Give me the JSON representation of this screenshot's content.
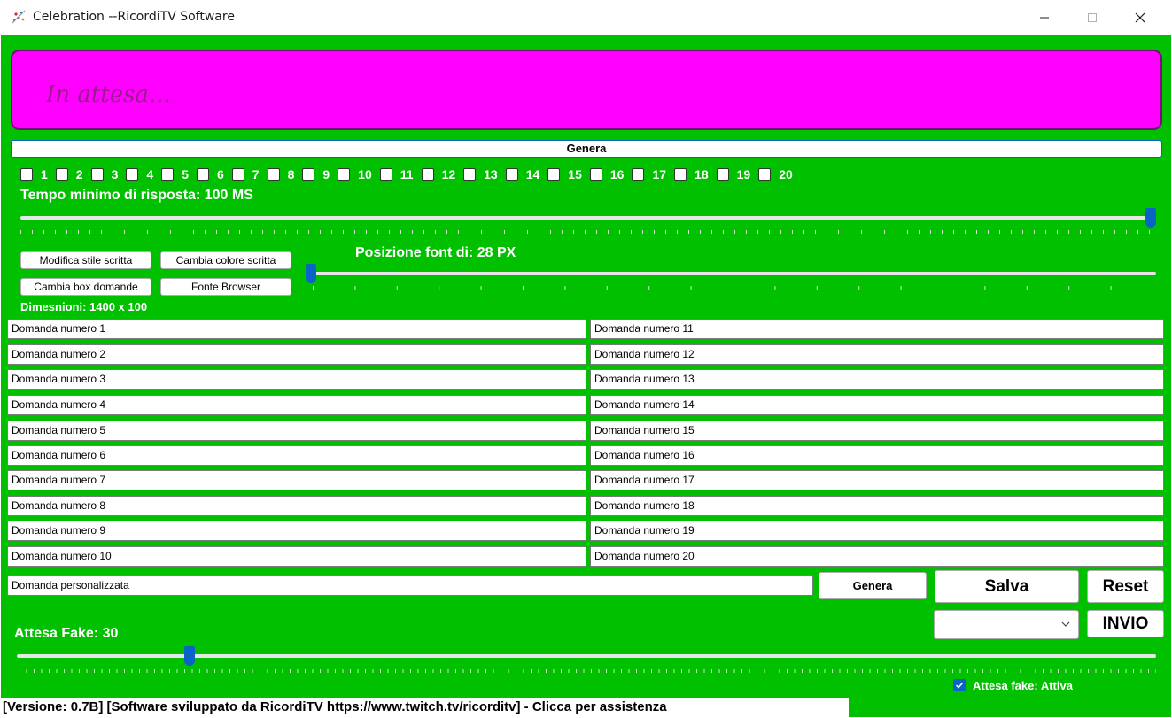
{
  "window": {
    "title": "Celebration --RicordiTV Software",
    "controls": {
      "minimize": "minimize-icon",
      "maximize": "maximize-icon",
      "close": "close-icon"
    }
  },
  "banner": {
    "text": "In attesa..."
  },
  "genera_top": "Genera",
  "checks": [
    "1",
    "2",
    "3",
    "4",
    "5",
    "6",
    "7",
    "8",
    "9",
    "10",
    "11",
    "12",
    "13",
    "14",
    "15",
    "16",
    "17",
    "18",
    "19",
    "20"
  ],
  "tempo": {
    "label": "Tempo minimo di risposta: 100 MS",
    "value_fraction": 1.0
  },
  "buttons": {
    "modifica_stile": "Modifica stile scritta",
    "cambia_colore": "Cambia colore scritta",
    "cambia_box": "Cambia box domande",
    "fonte_browser": "Fonte Browser",
    "genera": "Genera",
    "salva": "Salva",
    "reset": "Reset",
    "invio": "INVIO"
  },
  "posizione": {
    "label": "Posizione font di: 28 PX",
    "value_fraction": 0.0
  },
  "dimensioni": "Dimesnioni: 1400 x 100",
  "domande_left": [
    "Domanda numero 1",
    "Domanda numero 2",
    "Domanda numero 3",
    "Domanda numero 4",
    "Domanda numero 5",
    "Domanda numero 6",
    "Domanda numero 7",
    "Domanda numero 8",
    "Domanda numero 9",
    "Domanda numero 10"
  ],
  "domande_right": [
    "Domanda numero 11",
    "Domanda numero 12",
    "Domanda numero 13",
    "Domanda numero 14",
    "Domanda numero 15",
    "Domanda numero 16",
    "Domanda numero 17",
    "Domanda numero 18",
    "Domanda numero 19",
    "Domanda numero 20"
  ],
  "domanda_personalizzata": "Domanda personalizzata",
  "dropdown": {
    "selected": ""
  },
  "attesa_fake": {
    "label": "Attesa Fake: 30",
    "value_fraction": 0.148
  },
  "attesa_checkbox": {
    "label": "Attesa fake: Attiva",
    "checked": true
  },
  "status": "[Versione: 0.7B] [Software sviluppato da RicordiTV https://www.twitch.tv/ricorditv] - Clicca per assistenza",
  "colors": {
    "background": "#00c000",
    "banner": "#ff00ff",
    "accent": "#0a64c8"
  }
}
